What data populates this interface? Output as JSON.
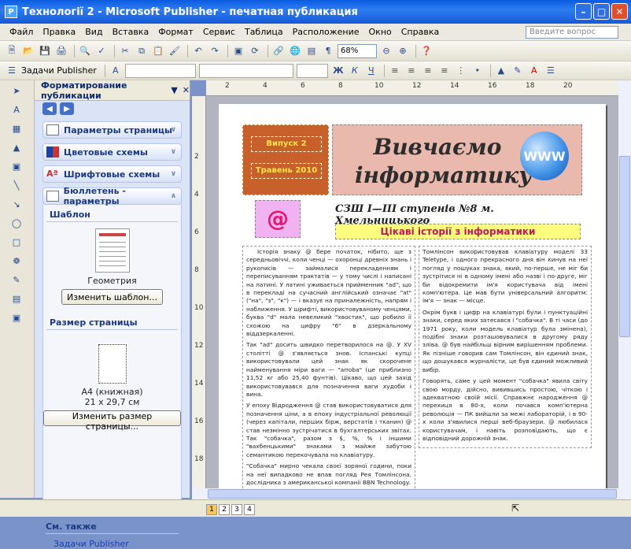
{
  "window": {
    "title": "Технології 2 - Microsoft Publisher - печатная публикация"
  },
  "menu": [
    "Файл",
    "Правка",
    "Вид",
    "Вставка",
    "Формат",
    "Сервис",
    "Таблица",
    "Расположение",
    "Окно",
    "Справка"
  ],
  "ask_placeholder": "Введите вопрос",
  "toolbar": {
    "zoom": "68%",
    "tasks_label": "Задачи Publisher"
  },
  "taskpane": {
    "title": "Форматирование публикации",
    "sections": [
      "Параметры страницы",
      "Цветовые схемы",
      "Шрифтовые схемы",
      "Бюллетень - параметры"
    ],
    "template_title": "Шаблон",
    "template_name": "Геометрия",
    "change_template": "Изменить шаблон...",
    "page_size_title": "Размер страницы",
    "page_size_name": "А4 (книжная)",
    "page_size_dims": "21 x 29,7 см",
    "change_size": "Изменить размер страницы...",
    "see_also": "См. также",
    "link": "Задачи Publisher"
  },
  "ruler": {
    "h": [
      "2",
      "4",
      "6",
      "8",
      "10",
      "12",
      "14",
      "16",
      "18",
      "20"
    ],
    "v": [
      "2",
      "4",
      "6",
      "8",
      "10",
      "12",
      "14",
      "16",
      "18",
      "20"
    ]
  },
  "doc": {
    "issue": "Випуск 2",
    "date": "Травень 2010",
    "title": "Вивчаємо інформатику",
    "globe": "WWW",
    "at": "@",
    "school": "СЗШ І—ІІІ ступенів №8 м. Хмельницького",
    "subtitle": "Цікаві історії з інформатики",
    "col1": [
      "Історія знаку @ бере початок, нібито, ще з середньовіччі, коли ченці — охоронці древніх знань і рукописів — займалися перекладенням і переписуванням трактатів — у тому числі і написані на латині. У латині уживається прийменник \"ad\", що в перекладі на сучасний англійський означає \"at\" (\"на\", \"з\", \"к\") — і вказує на приналежність, напрям і наближення. У шрифті, використовуваному ченцями, буква \"d\" мала невеликий \"хвостик\", що робило її схожою на цифру \"6\" в дзеркальному віддзеркаленні.",
      "Так \"ad\" досить швидко перетворилося на @. У XV столітті @ з'являється знов. Іспанські купці використовували цей знак як скорочене найменування міри ваги — \"arroba\" (це приблизно 11,52 кг або 25,40 фунтів). Цікаво, що цей захід використовувався для позначення ваги худоби і вина.",
      "У епоху Відродження @ став використовуватися для позначення ціни, а в епоху індустріальної революції (через капітали, перших бірж, верстатів і тканин) @ став незмінно зустрічатися в бухгалтерських звітах. Так \"собачка\", разом з $, %, % і іншими \"вахбенцькими\" знаками з майже забутою семантикою перекочувала на клавіатуру.",
      "\"Собачка\" мирно чекала своєї зоряної години, поки на неї випадково не впав погляд Рея Томлінсона, дослідника з американської компанії BBN Technology."
    ],
    "col2": [
      "Томлінсон використовував клавіатуру моделі 33 Teletype, і одного прекрасного дня він кинув на неї погляд у пошуках знака, який, по-перше, не міг би зустрітися ні в одному імені або назві і по-друге, міг би відокремити ім'я користувача від імені комп'ютера. Це мав бути універсальний алгоритм: ім'я — знак — місце.",
      "Окрім букв і цифр на клавіатурі були і пунктуаційні знаки, серед яких затесався і \"собачка\". В ті часи (до 1971 року, коли модель клавіатур була змінена), подібні знаки розташовувалися в другому ряду зліва. @ був найбільш вірним вирішенням проблеми. Як пізніше говорив сам Томлінсон, він єдиний знак, що дошукався журналісти, це був єдиний можливий вибір.",
      "Говорять, саме у цей момент \"собачка\" явила світу свою морду, дійсно, вивившись простою, чіткою і адекватною своїй місії. Справжнє народження @ перехиця в 80-х, коли почався комп'ютерна революція — ПК вийшли за межі лабораторій, і в 90-х коли з'явилися перші веб-браузери. @ любилася користувачам, і навіть розповідають, що є відповідний дорожній знак."
    ]
  },
  "pages": [
    "1",
    "2",
    "3",
    "4"
  ]
}
